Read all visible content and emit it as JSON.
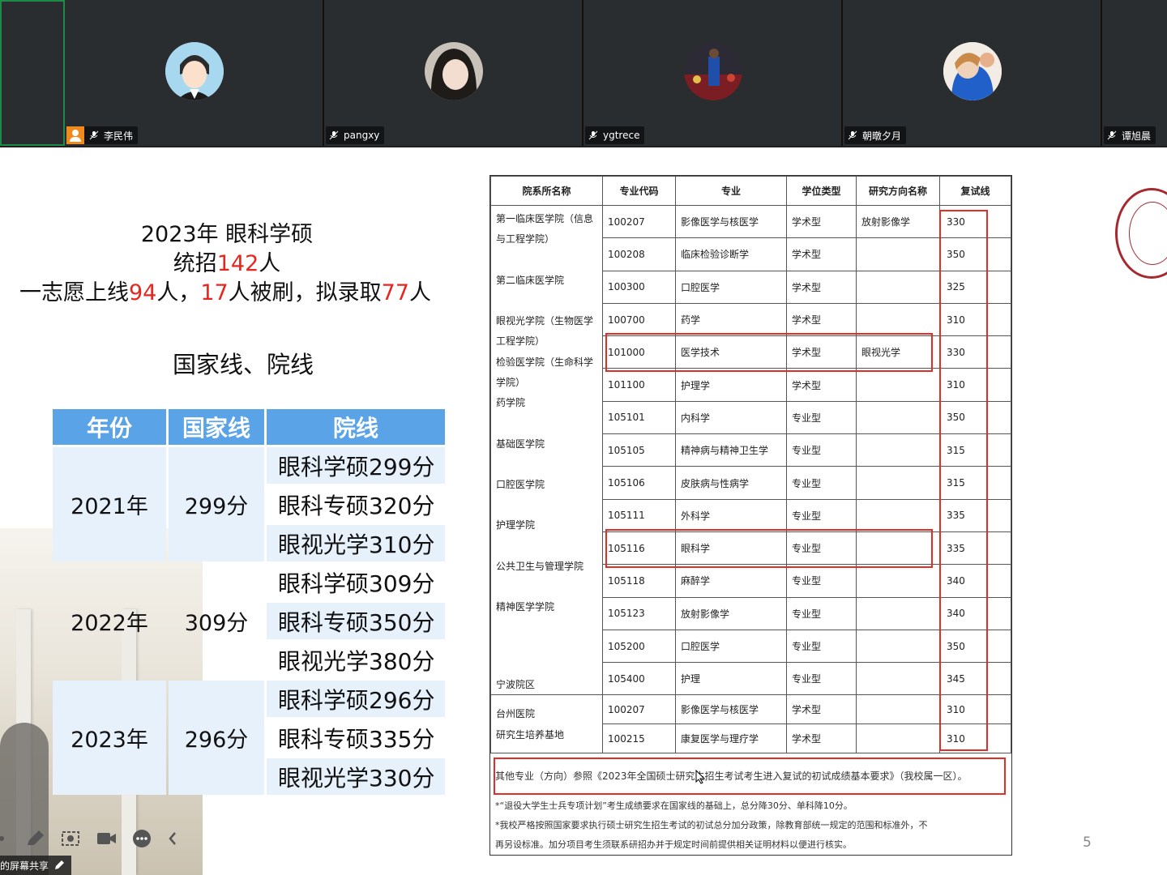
{
  "participants": [
    {
      "name": "",
      "active": true
    },
    {
      "name": "李民伟",
      "host": true
    },
    {
      "name": "pangxy"
    },
    {
      "name": "ygtrece"
    },
    {
      "name": "朝暾夕月"
    },
    {
      "name": "谭旭晨"
    }
  ],
  "slide": {
    "headline1": "2023年 眼科学硕",
    "headline2_a": "统招",
    "headline2_b": "142",
    "headline2_c": "人",
    "headline3_a": "一志愿上线",
    "headline3_b": "94",
    "headline3_c": "人，",
    "headline3_d": "17",
    "headline3_e": "人被刷，拟录取",
    "headline3_f": "77",
    "headline3_g": "人",
    "subtitle": "国家线、院线",
    "score_table": {
      "headers": [
        "年份",
        "国家线",
        "院线"
      ],
      "rows": [
        {
          "year": "2021年",
          "national": "299分",
          "lines": [
            "眼科学硕299分",
            "眼科专硕320分",
            "眼视光学310分"
          ]
        },
        {
          "year": "2022年",
          "national": "309分",
          "lines": [
            "眼科学硕309分",
            "眼科专硕350分",
            "眼视光学380分"
          ]
        },
        {
          "year": "2023年",
          "national": "296分",
          "lines": [
            "眼科学硕296分",
            "眼科专硕335分",
            "眼视光学330分"
          ]
        }
      ]
    },
    "page_number": "5"
  },
  "doc": {
    "headers": [
      "院系所名称",
      "专业代码",
      "专业",
      "学位类型",
      "研究方向名称",
      "复试线"
    ],
    "departments": [
      "第一临床医学院（信息与工程学院）",
      "第二临床医学院",
      "眼视光学院（生物医学工程学院）",
      "检验医学院（生命科学学院）",
      "药学院",
      "基础医学院",
      "口腔医学院",
      "护理学院",
      "公共卫生与管理学院",
      "精神医学学院",
      "宁波院区"
    ],
    "rows": [
      {
        "code": "100207",
        "major": "影像医学与核医学",
        "type": "学术型",
        "dir": "放射影像学",
        "score": "330"
      },
      {
        "code": "100208",
        "major": "临床检验诊断学",
        "type": "学术型",
        "dir": "",
        "score": "350"
      },
      {
        "code": "100300",
        "major": "口腔医学",
        "type": "学术型",
        "dir": "",
        "score": "325"
      },
      {
        "code": "100700",
        "major": "药学",
        "type": "学术型",
        "dir": "",
        "score": "310"
      },
      {
        "code": "101000",
        "major": "医学技术",
        "type": "学术型",
        "dir": "眼视光学",
        "score": "330"
      },
      {
        "code": "101100",
        "major": "护理学",
        "type": "学术型",
        "dir": "",
        "score": "310"
      },
      {
        "code": "105101",
        "major": "内科学",
        "type": "专业型",
        "dir": "",
        "score": "350"
      },
      {
        "code": "105105",
        "major": "精神病与精神卫生学",
        "type": "专业型",
        "dir": "",
        "score": "315"
      },
      {
        "code": "105106",
        "major": "皮肤病与性病学",
        "type": "专业型",
        "dir": "",
        "score": "315"
      },
      {
        "code": "105111",
        "major": "外科学",
        "type": "专业型",
        "dir": "",
        "score": "335"
      },
      {
        "code": "105116",
        "major": "眼科学",
        "type": "专业型",
        "dir": "",
        "score": "335"
      },
      {
        "code": "105118",
        "major": "麻醉学",
        "type": "专业型",
        "dir": "",
        "score": "340"
      },
      {
        "code": "105123",
        "major": "放射影像学",
        "type": "专业型",
        "dir": "",
        "score": "340"
      },
      {
        "code": "105200",
        "major": "口腔医学",
        "type": "专业型",
        "dir": "",
        "score": "350"
      },
      {
        "code": "105400",
        "major": "护理",
        "type": "专业型",
        "dir": "",
        "score": "345"
      }
    ],
    "taizhou_dept_1": "台州医院",
    "taizhou_dept_2": "研究生培养基地",
    "taizhou_rows": [
      {
        "code": "100207",
        "major": "影像医学与核医学",
        "type": "学术型",
        "dir": "",
        "score": "310"
      },
      {
        "code": "100215",
        "major": "康复医学与理疗学",
        "type": "学术型",
        "dir": "",
        "score": "310"
      }
    ],
    "note_main": "其他专业（方向）参照《2023年全国硕士研究生招生考试考生进入复试的初试成绩基本要求》（我校属一区）。",
    "note_1": "*“退役大学生士兵专项计划”考生成绩要求在国家线的基础上，总分降30分、单科降10分。",
    "note_2": "*我校严格按照国家要求执行硕士研究生招生考试的初试总分加分政策，除教育部统一规定的范围和标准外，不",
    "note_3": "再另设标准。加分项目考生须联系研招办并于规定时间前提供相关证明材料以便进行核实。"
  },
  "share_label": "的屏幕共享",
  "colors": {
    "accent_blue": "#5aa3e6",
    "red": "#e6261f",
    "green": "#5f8a3a",
    "orange": "#f0882e",
    "highlight_red": "#e52d27"
  }
}
